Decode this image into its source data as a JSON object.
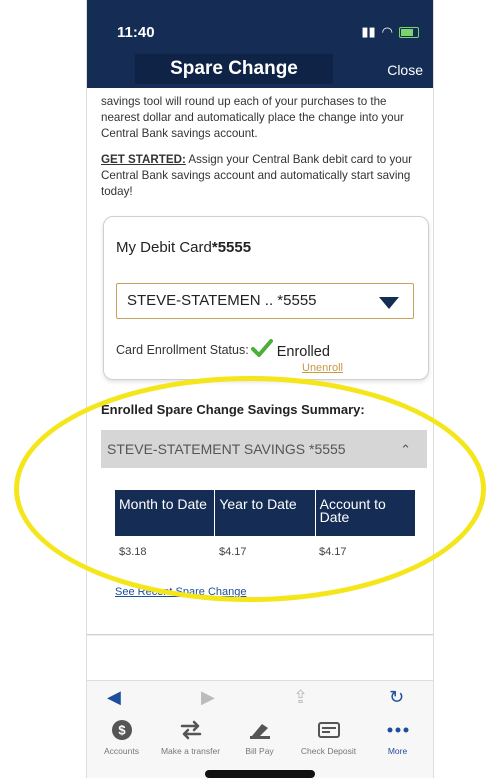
{
  "status": {
    "time": "11:40"
  },
  "nav": {
    "title": "Spare Change",
    "close_label": "Close"
  },
  "intro_text": "savings tool will round up each of your purchases to the nearest dollar and automatically place the change into your Central Bank savings account.",
  "get_started": {
    "label": "GET STARTED:",
    "text": " Assign your Central Bank debit card to your Central Bank savings account and automatically start saving today!"
  },
  "card": {
    "title_prefix": "My Debit Card",
    "title_number": "*5555",
    "selected_account": "STEVE-STATEMEN .. *5555",
    "status_label": "Card Enrollment Status:",
    "status_value": "Enrolled",
    "unenroll_label": "Unenroll"
  },
  "summary": {
    "title": "Enrolled Spare Change Savings Summary:",
    "account_name": "STEVE-STATEMENT SAVINGS *5555",
    "columns": [
      "Month to Date",
      "Year to Date",
      "Account to Date"
    ],
    "values": [
      "$3.18",
      "$4.17",
      "$4.17"
    ],
    "recent_link": "See Recent Spare Change"
  },
  "tabs": [
    {
      "label": "Accounts",
      "icon": "dollar-icon"
    },
    {
      "label": "Make a transfer",
      "icon": "transfer-icon"
    },
    {
      "label": "Bill Pay",
      "icon": "bill-pay-icon"
    },
    {
      "label": "Check Deposit",
      "icon": "check-deposit-icon"
    },
    {
      "label": "More",
      "icon": "more-icon"
    }
  ],
  "colors": {
    "navy": "#152d55",
    "accent_gold": "#c79a42",
    "highlight": "#f4e61a",
    "link_blue": "#1d4e9c"
  }
}
